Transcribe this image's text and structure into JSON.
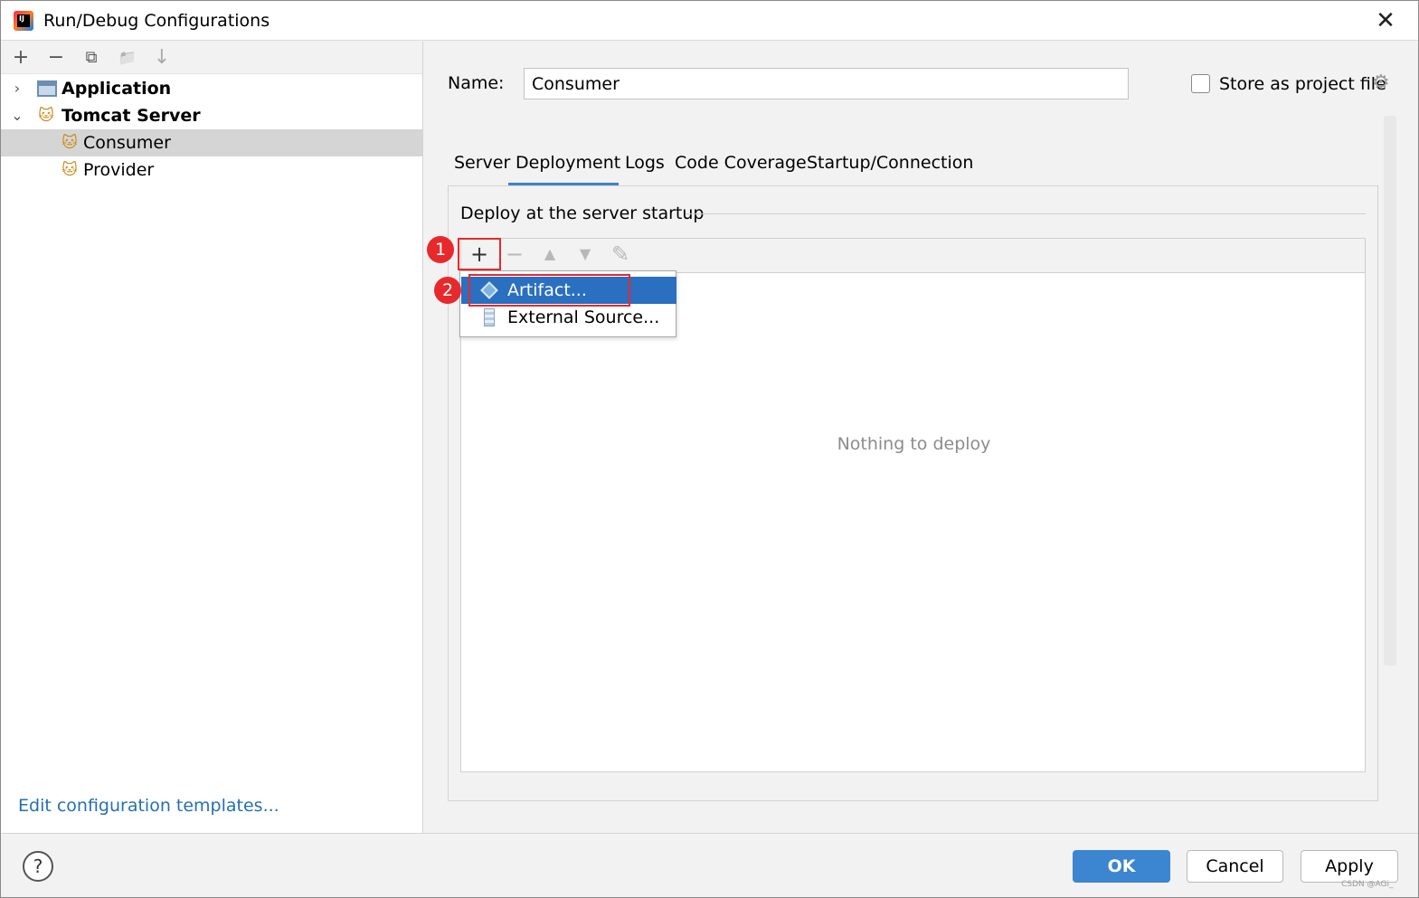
{
  "window": {
    "title": "Run/Debug Configurations",
    "close": "✕"
  },
  "left_toolbar": {
    "add": "+",
    "remove": "−",
    "copy": "⧉",
    "folder": "📁",
    "sort": "↓"
  },
  "tree": {
    "items": [
      {
        "label": "Application",
        "expanded": false
      },
      {
        "label": "Tomcat Server",
        "expanded": true
      },
      {
        "label": "Consumer",
        "selected": true
      },
      {
        "label": "Provider",
        "selected": false
      }
    ],
    "chevron_collapsed": "›",
    "chevron_expanded": "⌄"
  },
  "edit_templates_link": "Edit configuration templates...",
  "name_field": {
    "label": "Name:",
    "value": "Consumer"
  },
  "store_as_project_file": {
    "label": "Store as project file",
    "checked": false
  },
  "tabs": [
    {
      "label": "Server"
    },
    {
      "label": "Deployment",
      "active": true
    },
    {
      "label": "Logs"
    },
    {
      "label": "Code Coverage"
    },
    {
      "label": "Startup/Connection"
    }
  ],
  "deploy": {
    "section_title": "Deploy at the server startup",
    "empty_text": "Nothing to deploy",
    "toolbar": {
      "add": "+",
      "remove": "−",
      "up": "▲",
      "down": "▼",
      "edit": "✎"
    }
  },
  "popup_menu": {
    "items": [
      {
        "label": "Artifact...",
        "selected": true
      },
      {
        "label": "External Source...",
        "selected": false
      }
    ]
  },
  "annotations": {
    "badge1": "1",
    "badge2": "2"
  },
  "buttons": {
    "help": "?",
    "ok": "OK",
    "cancel": "Cancel",
    "apply": "Apply"
  },
  "watermark": "CSDN @AGi_",
  "colors": {
    "accent": "#3c85d0",
    "selection": "#2a6fc0",
    "annotation_red": "#e8292c",
    "link": "#2470b3"
  }
}
